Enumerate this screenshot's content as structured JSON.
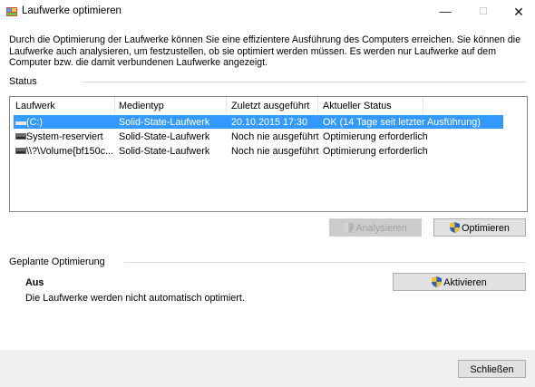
{
  "window": {
    "title": "Laufwerke optimieren",
    "minimize_glyph": "—",
    "maximize_glyph": "☐",
    "close_glyph": "✕"
  },
  "intro_text": "Durch die Optimierung der Laufwerke können Sie eine effizientere Ausführung des Computers erreichen. Sie können die Laufwerke auch analysieren, um festzustellen, ob sie optimiert werden müssen. Es werden nur Laufwerke auf dem Computer bzw. die damit verbundenen Laufwerke angezeigt.",
  "status_label": "Status",
  "columns": [
    "Laufwerk",
    "Medientyp",
    "Zuletzt ausgeführt",
    "Aktueller Status"
  ],
  "drives": [
    {
      "name": "(C:)",
      "media": "Solid-State-Laufwerk",
      "last_run": "20.10.2015 17:30",
      "status": "OK (14 Tage seit letzter Ausführung)",
      "selected": true,
      "icon": "windows-drive-icon"
    },
    {
      "name": "System-reserviert",
      "media": "Solid-State-Laufwerk",
      "last_run": "Noch nie ausgeführt",
      "status": "Optimierung erforderlich",
      "selected": false,
      "icon": "drive-icon"
    },
    {
      "name": "\\\\?\\Volume{bf150c...",
      "media": "Solid-State-Laufwerk",
      "last_run": "Noch nie ausgeführt",
      "status": "Optimierung erforderlich",
      "selected": false,
      "icon": "drive-icon"
    }
  ],
  "buttons": {
    "analyze": "Analysieren",
    "optimize": "Optimieren",
    "activate": "Aktivieren",
    "close": "Schließen"
  },
  "scheduled": {
    "label": "Geplante Optimierung",
    "state": "Aus",
    "description": "Die Laufwerke werden nicht automatisch optimiert."
  },
  "colors": {
    "selection": "#3399ff",
    "shield_blue": "#2c5fb3",
    "shield_yellow": "#f2c12e"
  }
}
